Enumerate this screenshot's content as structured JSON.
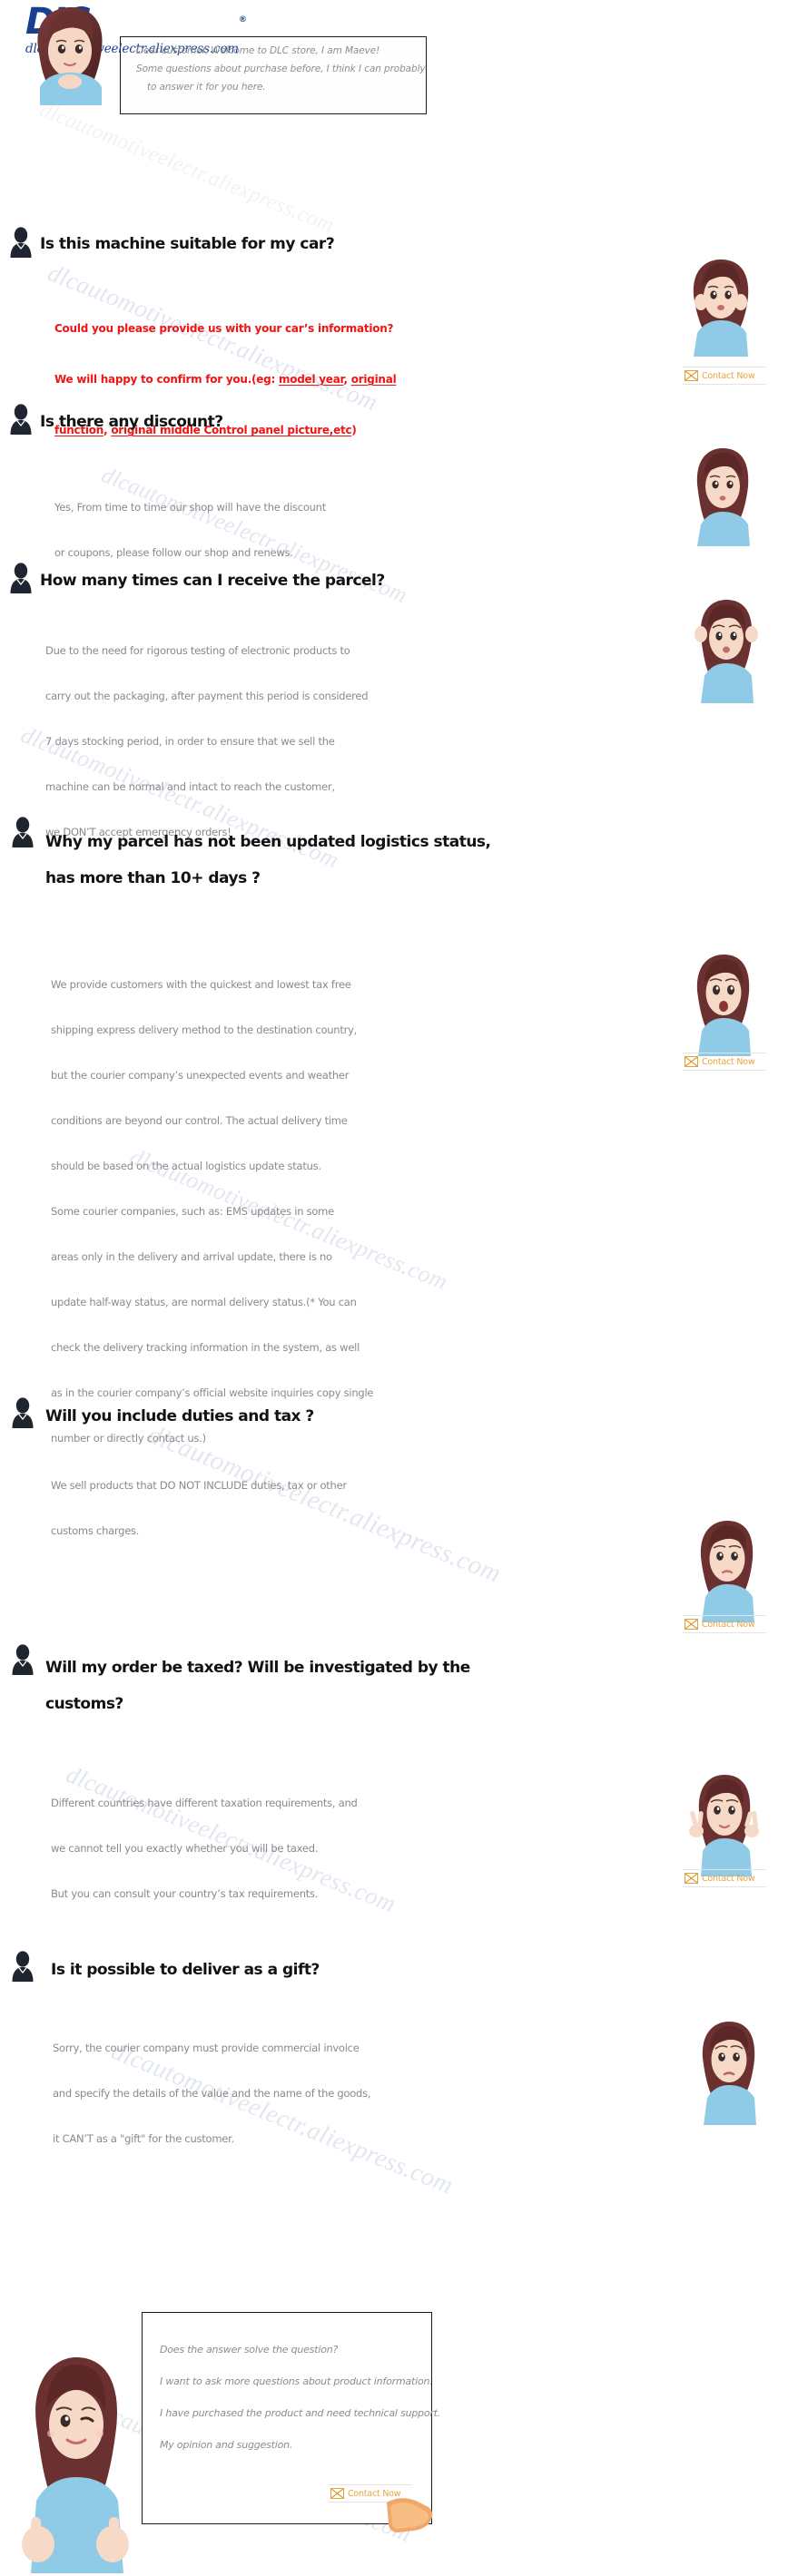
{
  "brand": {
    "logo_text": "DIC",
    "logo_registered": "®",
    "url": "dlcautomotiveelectr.aliexpress.com"
  },
  "watermark": {
    "text": "dlcautomotiveelectr.aliexpress.com"
  },
  "greeting": {
    "line1": "Dear customer, Welcome to DLC store, I am Maeve!",
    "line2": "Some questions about purchase before, I think I can probably",
    "line3": "to answer it for you here."
  },
  "contact": {
    "label": "Contact Now",
    "icon": "envelope-icon"
  },
  "faq": [
    {
      "id": "q1",
      "question": "Is this machine suitable for my car?",
      "answer_style": "red",
      "answer_lines": [
        "Could you please provide us with your car’s information?",
        "We will happy to confirm for you.(eg: model year, original",
        "function, original middle Control panel picture,etc)"
      ],
      "underlined_terms": [
        "model year",
        "original",
        "function",
        "original middle Control panel picture,etc"
      ],
      "avatar": "woman-surprised-hands-on-cheeks",
      "has_contact": true
    },
    {
      "id": "q2",
      "question": "Is there any discount?",
      "answer_style": "grey",
      "answer_lines": [
        "Yes, From time to time our shop will have the discount",
        "or coupons, please follow our shop and renews."
      ],
      "avatar": "woman-shushing",
      "has_contact": false
    },
    {
      "id": "q3",
      "question": "How many times can I receive the parcel?",
      "answer_style": "grey",
      "answer_lines": [
        "Due to the need for rigorous testing of electronic products to",
        "carry out the packaging, after payment this period is considered",
        "7 days stocking period, in order to ensure that we sell the",
        "machine can be normal and intact to reach the customer,",
        "we DON’T accept emergency orders!"
      ],
      "avatar": "woman-hands-on-head",
      "has_contact": false
    },
    {
      "id": "q4",
      "question": "Why my parcel has not been updated logistics status,\nhas more than 10+ days ?",
      "answer_style": "grey",
      "answer_lines": [
        "We provide customers with the quickest and lowest tax free",
        "shipping express delivery method to the destination country,",
        "but the courier company’s unexpected events and weather",
        "conditions are beyond our control. The actual delivery time",
        "should be based on the actual logistics update status.",
        "Some courier companies, such as: EMS updates in some",
        "areas only in the delivery and arrival update, there is no",
        "update half-way status, are normal delivery status.(* You can",
        " check the delivery tracking information in the system, as well",
        "as in the courier company’s official website inquiries copy single",
        " number or directly contact us.)"
      ],
      "avatar": "woman-shocked",
      "has_contact": true
    },
    {
      "id": "q5",
      "question": "Will you include duties and tax ?",
      "answer_style": "grey",
      "answer_lines": [
        "We sell products that DO NOT INCLUDE duties, tax or other",
        "customs charges."
      ],
      "avatar": "woman-worried",
      "has_contact": true
    },
    {
      "id": "q6",
      "question": "Will my order be taxed? Will be investigated by the\ncustoms?",
      "answer_style": "grey",
      "answer_lines": [
        "Different countries have different taxation requirements, and",
        "we cannot tell you exactly whether you will be taxed.",
        "But you can consult your country’s tax requirements."
      ],
      "avatar": "woman-peace-signs",
      "has_contact": true
    },
    {
      "id": "q7",
      "question": "Is it possible to deliver as a gift?",
      "answer_style": "grey",
      "answer_lines": [
        "Sorry, the courier company must provide commercial invoice",
        "and specify the details of the value and the name of the goods,",
        "it CAN’T as a \"gift\" for the customer."
      ],
      "avatar": "woman-sad",
      "has_contact": false
    }
  ],
  "footer": {
    "line1": "Does the answer solve the question?",
    "line2": "I want to ask more questions about product information.",
    "line3": "I have purchased the product and need technical support.",
    "line4": "My opinion and suggestion.",
    "avatar": "woman-winking-thumbs-up",
    "pointer": "pointing-hand-icon"
  },
  "colors": {
    "brand_blue": "#1b3f8f",
    "accent_orange": "#e8a33d",
    "alert_red": "#f01414",
    "body_grey": "#8a8a8a",
    "heading_black": "#121212"
  }
}
